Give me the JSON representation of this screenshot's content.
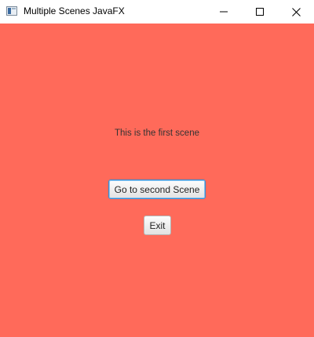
{
  "window": {
    "title": "Multiple Scenes JavaFX",
    "icon": "java-app-icon",
    "controls": {
      "minimize_icon": "minimize-icon",
      "maximize_icon": "maximize-icon",
      "close_icon": "close-icon"
    }
  },
  "scene": {
    "background_color": "#ff6a5a",
    "label": "This is the first scene",
    "buttons": {
      "second_scene": "Go to second Scene",
      "exit": "Exit"
    },
    "focused_button": "second_scene",
    "focus_color": "#2f8fd8"
  }
}
